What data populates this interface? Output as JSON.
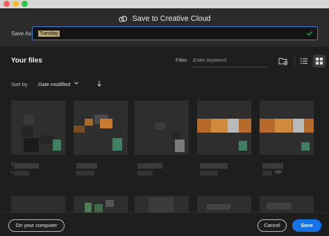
{
  "dialog": {
    "title": "Save to Creative Cloud"
  },
  "save_as": {
    "label": "Save As",
    "value": "Tuesday"
  },
  "files": {
    "heading": "Your files",
    "filter_label": "Filter",
    "filter_placeholder": "Enter keyword",
    "sort_label": "Sort by",
    "sort_value": "Date modified",
    "captions": [
      "T",
      "I",
      "ago"
    ]
  },
  "footer": {
    "computer_label": "On your computer",
    "cancel_label": "Cancel",
    "save_label": "Save"
  },
  "colors": {
    "accent": "#1473e6",
    "focus_border": "#3d7ccf",
    "check": "#2fa84f"
  },
  "icons": [
    "creative-cloud-icon",
    "checkmark-icon",
    "new-folder-icon",
    "list-view-icon",
    "grid-view-icon",
    "chevron-down-icon",
    "sort-arrow-icon"
  ]
}
